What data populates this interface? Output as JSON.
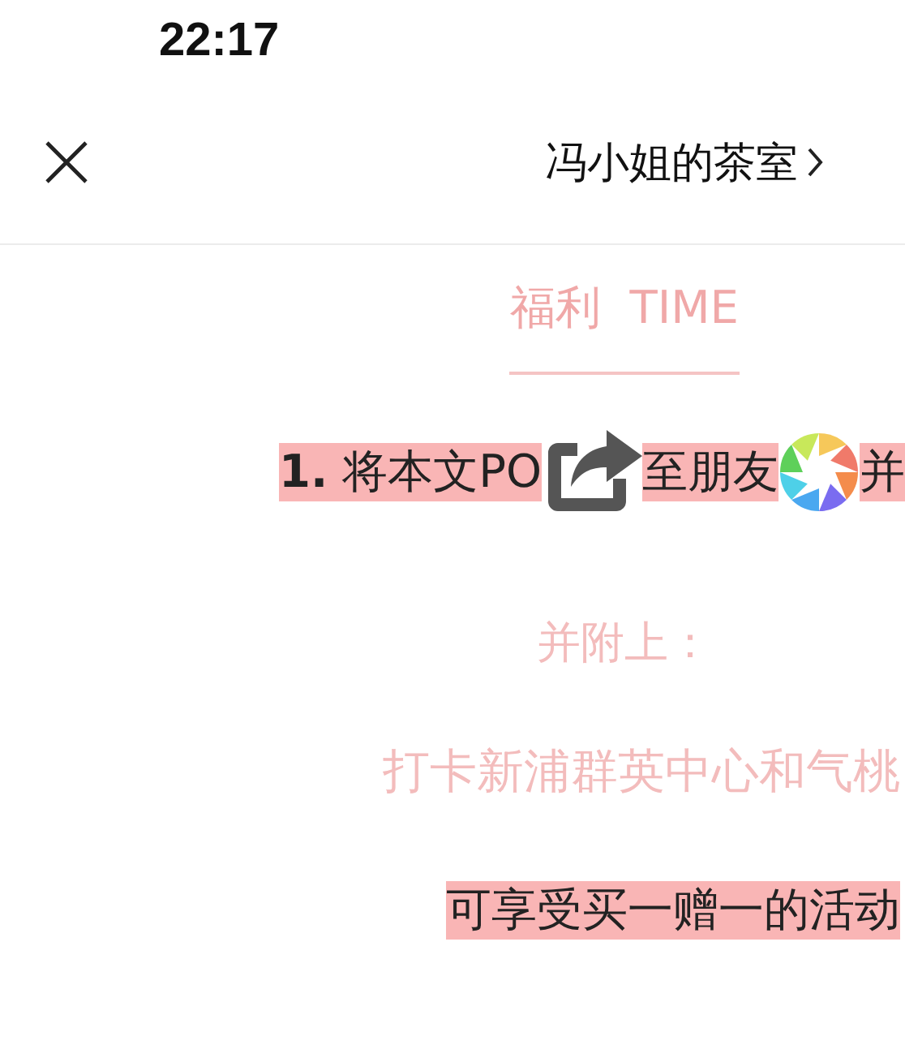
{
  "status_bar": {
    "time": "22:17"
  },
  "nav": {
    "title": "冯小姐的茶室"
  },
  "blocks": [
    {
      "kind": "heading",
      "text": "福利  TIME"
    },
    {
      "kind": "mixed",
      "segments": [
        {
          "kind": "text",
          "text": "**1.** 将本文PO"
        },
        {
          "kind": "share"
        },
        {
          "kind": "text",
          "text": "至朋友"
        },
        {
          "kind": "aperture"
        },
        {
          "kind": "text",
          "text": "并"
        }
      ]
    },
    {
      "kind": "plain",
      "text": "并附上："
    },
    {
      "kind": "plain-edge",
      "text": "打卡新浦群英中心和气桃"
    },
    {
      "kind": "highlight",
      "text": "可享受买一赠一的活动"
    }
  ]
}
